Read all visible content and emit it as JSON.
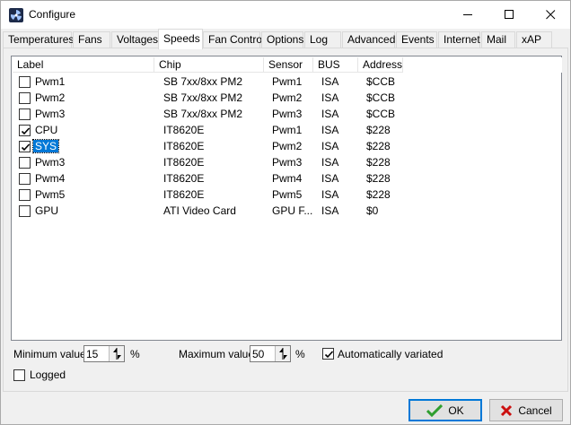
{
  "window": {
    "title": "Configure"
  },
  "tabs": [
    {
      "label": "Temperatures"
    },
    {
      "label": "Fans"
    },
    {
      "label": "Voltages"
    },
    {
      "label": "Speeds",
      "active": true
    },
    {
      "label": "Fan Control"
    },
    {
      "label": "Options"
    },
    {
      "label": "Log"
    },
    {
      "label": "Advanced"
    },
    {
      "label": "Events"
    },
    {
      "label": "Internet"
    },
    {
      "label": "Mail"
    },
    {
      "label": "xAP"
    }
  ],
  "list": {
    "columns": [
      "Label",
      "Chip",
      "Sensor",
      "BUS",
      "Address"
    ],
    "rows": [
      {
        "checked": false,
        "label": "Pwm1",
        "chip": "SB 7xx/8xx PM2",
        "sensor": "Pwm1",
        "bus": "ISA",
        "address": "$CCB"
      },
      {
        "checked": false,
        "label": "Pwm2",
        "chip": "SB 7xx/8xx PM2",
        "sensor": "Pwm2",
        "bus": "ISA",
        "address": "$CCB"
      },
      {
        "checked": false,
        "label": "Pwm3",
        "chip": "SB 7xx/8xx PM2",
        "sensor": "Pwm3",
        "bus": "ISA",
        "address": "$CCB"
      },
      {
        "checked": true,
        "label": "CPU",
        "chip": "IT8620E",
        "sensor": "Pwm1",
        "bus": "ISA",
        "address": "$228"
      },
      {
        "checked": true,
        "label": "SYS",
        "chip": "IT8620E",
        "sensor": "Pwm2",
        "bus": "ISA",
        "address": "$228",
        "selected": true
      },
      {
        "checked": false,
        "label": "Pwm3",
        "chip": "IT8620E",
        "sensor": "Pwm3",
        "bus": "ISA",
        "address": "$228"
      },
      {
        "checked": false,
        "label": "Pwm4",
        "chip": "IT8620E",
        "sensor": "Pwm4",
        "bus": "ISA",
        "address": "$228"
      },
      {
        "checked": false,
        "label": "Pwm5",
        "chip": "IT8620E",
        "sensor": "Pwm5",
        "bus": "ISA",
        "address": "$228"
      },
      {
        "checked": false,
        "label": "GPU",
        "chip": "ATI Video Card",
        "sensor": "GPU F...",
        "bus": "ISA",
        "address": "$0"
      }
    ]
  },
  "controls": {
    "min_label": "Minimum value",
    "min_value": "15",
    "min_unit": "%",
    "max_label": "Maximum value",
    "max_value": "50",
    "max_unit": "%",
    "auto_label": "Automatically variated",
    "auto_checked": true,
    "logged_label": "Logged",
    "logged_checked": false
  },
  "buttons": {
    "ok_label": "OK",
    "cancel_label": "Cancel"
  },
  "colors": {
    "selection": "#0078d7",
    "ok_icon": "#2e9e2e",
    "cancel_icon": "#cc1010"
  }
}
